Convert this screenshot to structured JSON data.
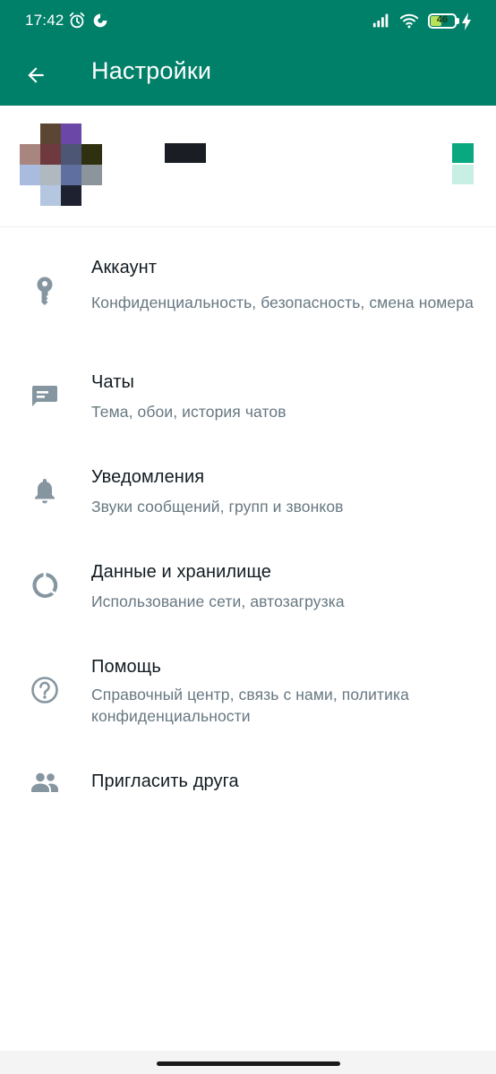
{
  "status_bar": {
    "time": "17:42",
    "battery_level": "46",
    "battery_fraction": 0.46,
    "icons": [
      "alarm-icon",
      "app-notification-icon",
      "signal-icon",
      "wifi-icon",
      "battery-icon",
      "charging-icon"
    ]
  },
  "app_bar": {
    "title": "Настройки",
    "back_icon": "arrow-back-icon",
    "background": "#008069"
  },
  "profile": {
    "avatar": "pixelated-avatar",
    "name": "",
    "qr_icon": "qr-code-icon"
  },
  "menu": {
    "items": [
      {
        "title": "Аккаунт",
        "subtitle": "Конфиденциальность, безопасность, смена номера",
        "icon": "key-icon"
      },
      {
        "title": "Чаты",
        "subtitle": "Тема, обои, история чатов",
        "icon": "chat-icon"
      },
      {
        "title": "Уведомления",
        "subtitle": "Звуки сообщений, групп и звонков",
        "icon": "bell-icon"
      },
      {
        "title": "Данные и хранилище",
        "subtitle": "Использование сети, автозагрузка",
        "icon": "data-usage-icon"
      },
      {
        "title": "Помощь",
        "subtitle": "Справочный центр, связь с нами, политика конфиденциальности",
        "icon": "help-icon"
      },
      {
        "title": "Пригласить друга",
        "subtitle": "",
        "icon": "people-icon"
      }
    ]
  },
  "colors": {
    "accent": "#008069",
    "icon_gray": "#8696a0",
    "title_text": "#111b21",
    "subtitle_text": "#667781"
  }
}
